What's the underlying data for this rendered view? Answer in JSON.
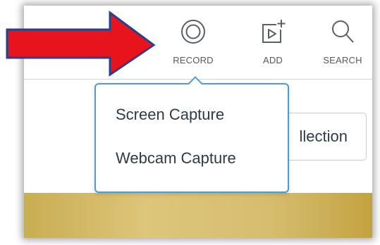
{
  "toolbar": {
    "record": {
      "label": "RECORD",
      "icon": "record-icon"
    },
    "add": {
      "label": "ADD",
      "icon": "add-media-icon"
    },
    "search": {
      "label": "SEARCH",
      "icon": "search-icon"
    }
  },
  "dropdown": {
    "items": [
      {
        "label": "Screen Capture"
      },
      {
        "label": "Webcam Capture"
      }
    ]
  },
  "collection_button": {
    "label": "llection"
  },
  "colors": {
    "arrow_fill": "#e8141b",
    "arrow_stroke": "#2b3f8c",
    "dropdown_border": "#4a9bd8",
    "banner_gold": "#d6bd70",
    "icon_gray": "#5a5f63"
  }
}
